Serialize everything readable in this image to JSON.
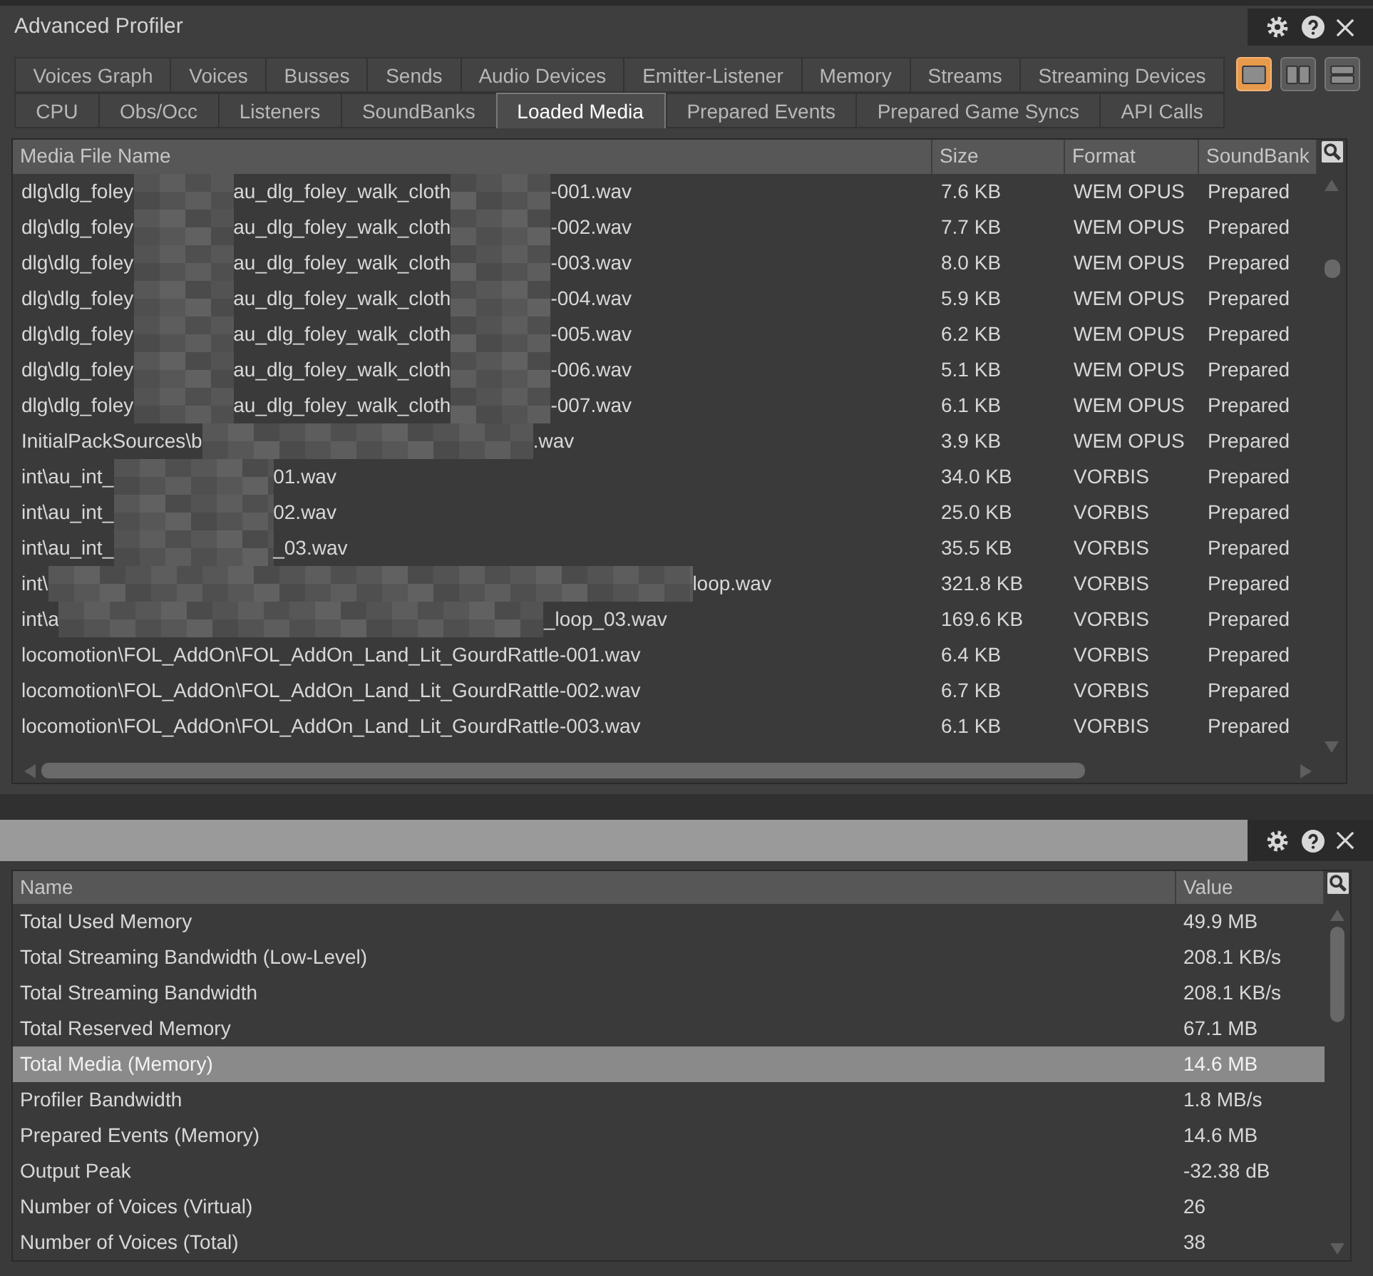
{
  "window": {
    "title": "Advanced Profiler"
  },
  "tab_rows": [
    {
      "tabs": [
        {
          "label": "Voices Graph",
          "selected": false
        },
        {
          "label": "Voices",
          "selected": false
        },
        {
          "label": "Busses",
          "selected": false
        },
        {
          "label": "Sends",
          "selected": false
        },
        {
          "label": "Audio Devices",
          "selected": false
        },
        {
          "label": "Emitter-Listener",
          "selected": false
        },
        {
          "label": "Memory",
          "selected": false
        },
        {
          "label": "Streams",
          "selected": false
        },
        {
          "label": "Streaming Devices",
          "selected": false
        }
      ]
    },
    {
      "tabs": [
        {
          "label": "CPU",
          "selected": false
        },
        {
          "label": "Obs/Occ",
          "selected": false
        },
        {
          "label": "Listeners",
          "selected": false
        },
        {
          "label": "SoundBanks",
          "selected": false
        },
        {
          "label": "Loaded Media",
          "selected": true
        },
        {
          "label": "Prepared Events",
          "selected": false
        },
        {
          "label": "Prepared Game Syncs",
          "selected": false
        },
        {
          "label": "API Calls",
          "selected": false
        }
      ]
    }
  ],
  "layout_buttons": [
    {
      "kind": "single",
      "selected": true
    },
    {
      "kind": "columns",
      "selected": false
    },
    {
      "kind": "rows",
      "selected": false
    }
  ],
  "media_table": {
    "columns": [
      "Media File Name",
      "Size",
      "Format",
      "SoundBank"
    ],
    "rows": [
      {
        "name": [
          {
            "kind": "text",
            "text": "dlg\\dlg_foley"
          },
          {
            "kind": "redacted"
          },
          {
            "kind": "text",
            "text": "au_dlg_foley_walk_cloth"
          },
          {
            "kind": "redacted"
          },
          {
            "kind": "text",
            "text": "-001.wav"
          }
        ],
        "size": "7.6 KB",
        "format": "WEM OPUS",
        "soundbank": "Prepared"
      },
      {
        "name": [
          {
            "kind": "text",
            "text": "dlg\\dlg_foley"
          },
          {
            "kind": "redacted"
          },
          {
            "kind": "text",
            "text": "au_dlg_foley_walk_cloth"
          },
          {
            "kind": "redacted"
          },
          {
            "kind": "text",
            "text": "-002.wav"
          }
        ],
        "size": "7.7 KB",
        "format": "WEM OPUS",
        "soundbank": "Prepared"
      },
      {
        "name": [
          {
            "kind": "text",
            "text": "dlg\\dlg_foley"
          },
          {
            "kind": "redacted"
          },
          {
            "kind": "text",
            "text": "au_dlg_foley_walk_cloth"
          },
          {
            "kind": "redacted"
          },
          {
            "kind": "text",
            "text": "-003.wav"
          }
        ],
        "size": "8.0 KB",
        "format": "WEM OPUS",
        "soundbank": "Prepared"
      },
      {
        "name": [
          {
            "kind": "text",
            "text": "dlg\\dlg_foley"
          },
          {
            "kind": "redacted"
          },
          {
            "kind": "text",
            "text": "au_dlg_foley_walk_cloth"
          },
          {
            "kind": "redacted"
          },
          {
            "kind": "text",
            "text": "-004.wav"
          }
        ],
        "size": "5.9 KB",
        "format": "WEM OPUS",
        "soundbank": "Prepared"
      },
      {
        "name": [
          {
            "kind": "text",
            "text": "dlg\\dlg_foley"
          },
          {
            "kind": "redacted"
          },
          {
            "kind": "text",
            "text": "au_dlg_foley_walk_cloth"
          },
          {
            "kind": "redacted"
          },
          {
            "kind": "text",
            "text": "-005.wav"
          }
        ],
        "size": "6.2 KB",
        "format": "WEM OPUS",
        "soundbank": "Prepared"
      },
      {
        "name": [
          {
            "kind": "text",
            "text": "dlg\\dlg_foley"
          },
          {
            "kind": "redacted"
          },
          {
            "kind": "text",
            "text": "au_dlg_foley_walk_cloth"
          },
          {
            "kind": "redacted"
          },
          {
            "kind": "text",
            "text": "-006.wav"
          }
        ],
        "size": "5.1 KB",
        "format": "WEM OPUS",
        "soundbank": "Prepared"
      },
      {
        "name": [
          {
            "kind": "text",
            "text": "dlg\\dlg_foley"
          },
          {
            "kind": "redacted"
          },
          {
            "kind": "text",
            "text": "au_dlg_foley_walk_cloth"
          },
          {
            "kind": "redacted"
          },
          {
            "kind": "text",
            "text": "-007.wav"
          }
        ],
        "size": "6.1 KB",
        "format": "WEM OPUS",
        "soundbank": "Prepared"
      },
      {
        "name": [
          {
            "kind": "text",
            "text": "InitialPackSources\\b"
          },
          {
            "kind": "redacted"
          },
          {
            "kind": "text",
            "text": ".wav"
          }
        ],
        "size": "3.9 KB",
        "format": "WEM OPUS",
        "soundbank": "Prepared"
      },
      {
        "name": [
          {
            "kind": "text",
            "text": "int\\au_int_"
          },
          {
            "kind": "redacted"
          },
          {
            "kind": "text",
            "text": "01.wav"
          }
        ],
        "size": "34.0 KB",
        "format": "VORBIS",
        "soundbank": "Prepared"
      },
      {
        "name": [
          {
            "kind": "text",
            "text": "int\\au_int_"
          },
          {
            "kind": "redacted"
          },
          {
            "kind": "text",
            "text": "02.wav"
          }
        ],
        "size": "25.0 KB",
        "format": "VORBIS",
        "soundbank": "Prepared"
      },
      {
        "name": [
          {
            "kind": "text",
            "text": "int\\au_int_"
          },
          {
            "kind": "redacted"
          },
          {
            "kind": "text",
            "text": "_03.wav"
          }
        ],
        "size": "35.5 KB",
        "format": "VORBIS",
        "soundbank": "Prepared"
      },
      {
        "name": [
          {
            "kind": "text",
            "text": "int\\"
          },
          {
            "kind": "redacted"
          },
          {
            "kind": "text",
            "text": "loop.wav"
          }
        ],
        "size": "321.8 KB",
        "format": "VORBIS",
        "soundbank": "Prepared"
      },
      {
        "name": [
          {
            "kind": "text",
            "text": "int\\a"
          },
          {
            "kind": "redacted"
          },
          {
            "kind": "text",
            "text": "_loop_03.wav"
          }
        ],
        "size": "169.6 KB",
        "format": "VORBIS",
        "soundbank": "Prepared"
      },
      {
        "name": [
          {
            "kind": "text",
            "text": "locomotion\\FOL_AddOn\\FOL_AddOn_Land_Lit_GourdRattle-001.wav"
          }
        ],
        "size": "6.4 KB",
        "format": "VORBIS",
        "soundbank": "Prepared"
      },
      {
        "name": [
          {
            "kind": "text",
            "text": "locomotion\\FOL_AddOn\\FOL_AddOn_Land_Lit_GourdRattle-002.wav"
          }
        ],
        "size": "6.7 KB",
        "format": "VORBIS",
        "soundbank": "Prepared"
      },
      {
        "name": [
          {
            "kind": "text",
            "text": "locomotion\\FOL_AddOn\\FOL_AddOn_Land_Lit_GourdRattle-003.wav"
          }
        ],
        "size": "6.1 KB",
        "format": "VORBIS",
        "soundbank": "Prepared"
      }
    ]
  },
  "stats_table": {
    "columns": [
      "Name",
      "Value"
    ],
    "rows": [
      {
        "name": "Total Used Memory",
        "value": "49.9 MB",
        "selected": false
      },
      {
        "name": "Total Streaming Bandwidth (Low-Level)",
        "value": "208.1 KB/s",
        "selected": false
      },
      {
        "name": "Total Streaming Bandwidth",
        "value": "208.1 KB/s",
        "selected": false
      },
      {
        "name": "Total Reserved Memory",
        "value": "67.1 MB",
        "selected": false
      },
      {
        "name": "Total Media (Memory)",
        "value": "14.6 MB",
        "selected": true
      },
      {
        "name": "Profiler Bandwidth",
        "value": "1.8 MB/s",
        "selected": false
      },
      {
        "name": "Prepared Events (Memory)",
        "value": "14.6 MB",
        "selected": false
      },
      {
        "name": "Output Peak",
        "value": "-32.38 dB",
        "selected": false
      },
      {
        "name": "Number of Voices (Virtual)",
        "value": "26",
        "selected": false
      },
      {
        "name": "Number of Voices (Total)",
        "value": "38",
        "selected": false
      }
    ]
  }
}
